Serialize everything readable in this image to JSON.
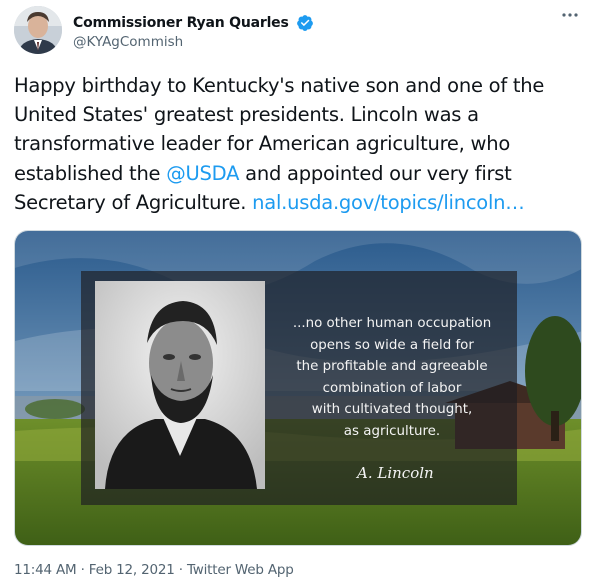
{
  "author": {
    "display_name": "Commissioner Ryan Quarles",
    "handle": "@KYAgCommish"
  },
  "more_icon": "more-horizontal-icon",
  "verified_icon": "verified-badge-icon",
  "tweet": {
    "text_1": "Happy birthday to Kentucky's native son and one of the United States' greatest presidents. Lincoln was a transformative leader for American agriculture, who established the ",
    "mention": "@USDA",
    "text_2": " and appointed our very first Secretary of Agriculture. ",
    "link": "nal.usda.gov/topics/lincoln…"
  },
  "media": {
    "quote_lines": [
      "...no other human occupation",
      "opens so wide a field for",
      "the profitable and agreeable",
      "combination of labor",
      "with cultivated thought,",
      "as agriculture."
    ],
    "signature": "A. Lincoln"
  },
  "meta": {
    "time": "11:44 AM",
    "sep1": " · ",
    "date": "Feb 12, 2021",
    "sep2": " · ",
    "source": "Twitter Web App"
  },
  "colors": {
    "link": "#1d9bf0",
    "secondary_text": "#536471",
    "verified": "#1d9bf0"
  }
}
